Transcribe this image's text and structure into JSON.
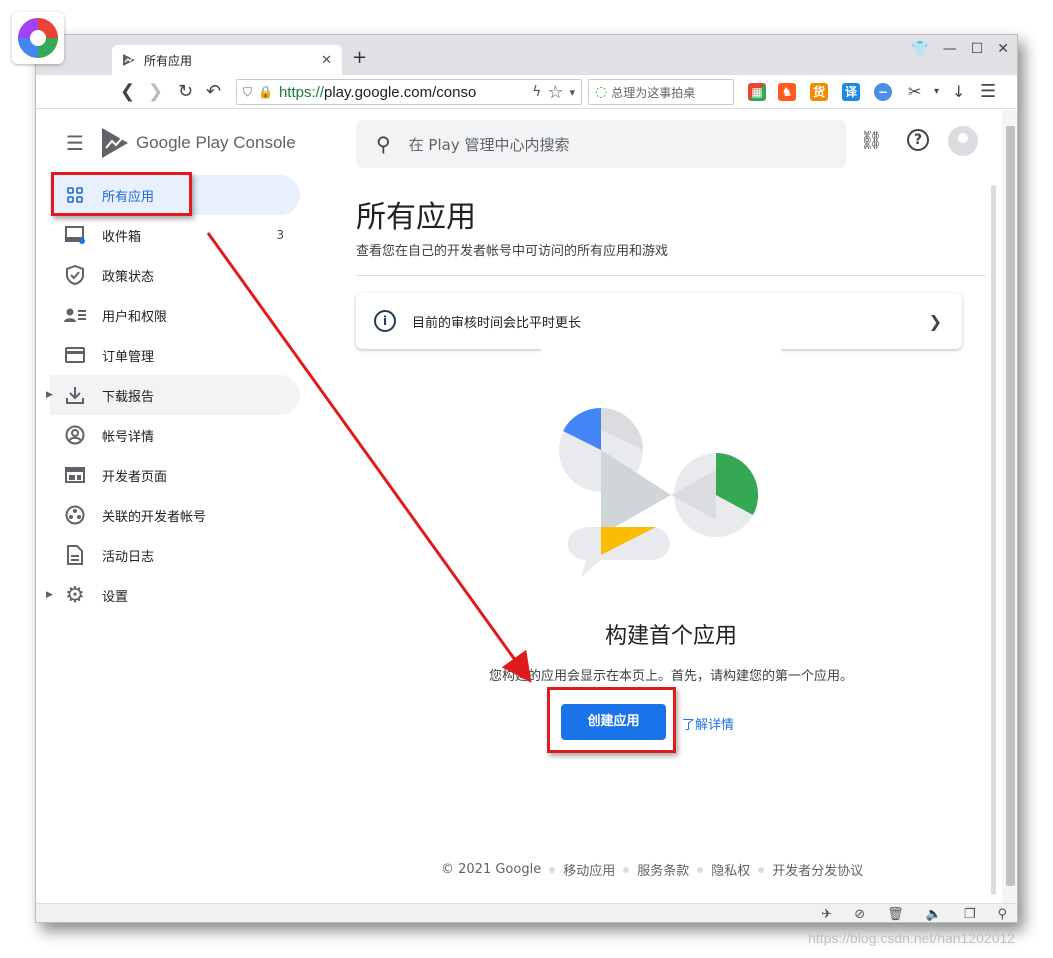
{
  "browser": {
    "tab_title": "所有应用",
    "url_scheme": "https://",
    "url_host": "play.google.com/conso",
    "search_placeholder": "总理为这事拍桌"
  },
  "sidebar": {
    "brand": "Google Play Console",
    "items": [
      {
        "label": "所有应用",
        "icon": "apps-grid-icon"
      },
      {
        "label": "收件箱",
        "icon": "inbox-icon",
        "count": "3"
      },
      {
        "label": "政策状态",
        "icon": "shield-icon"
      },
      {
        "label": "用户和权限",
        "icon": "users-icon"
      },
      {
        "label": "订单管理",
        "icon": "card-icon"
      },
      {
        "label": "下载报告",
        "icon": "download-icon"
      },
      {
        "label": "帐号详情",
        "icon": "account-icon"
      },
      {
        "label": "开发者页面",
        "icon": "developer-page-icon"
      },
      {
        "label": "关联的开发者帐号",
        "icon": "linked-accounts-icon"
      },
      {
        "label": "活动日志",
        "icon": "log-icon"
      },
      {
        "label": "设置",
        "icon": "gear-icon"
      }
    ]
  },
  "main": {
    "search_placeholder": "在 Play 管理中心内搜索",
    "title": "所有应用",
    "subtitle": "查看您在自己的开发者帐号中可访问的所有应用和游戏",
    "banner": "目前的审核时间会比平时更长",
    "empty_title": "构建首个应用",
    "empty_text": "您构建的应用会显示在本页上。首先，请构建您的第一个应用。",
    "create_button": "创建应用",
    "learn_more": "了解详情"
  },
  "footer": {
    "copyright": "© 2021 Google",
    "links": [
      "移动应用",
      "服务条款",
      "隐私权",
      "开发者分发协议"
    ]
  },
  "watermark": "https://blog.csdn.net/han1202012",
  "colors": {
    "accent": "#1a73e8",
    "highlight": "#e01b1b",
    "active_bg": "#e8f0fe"
  }
}
